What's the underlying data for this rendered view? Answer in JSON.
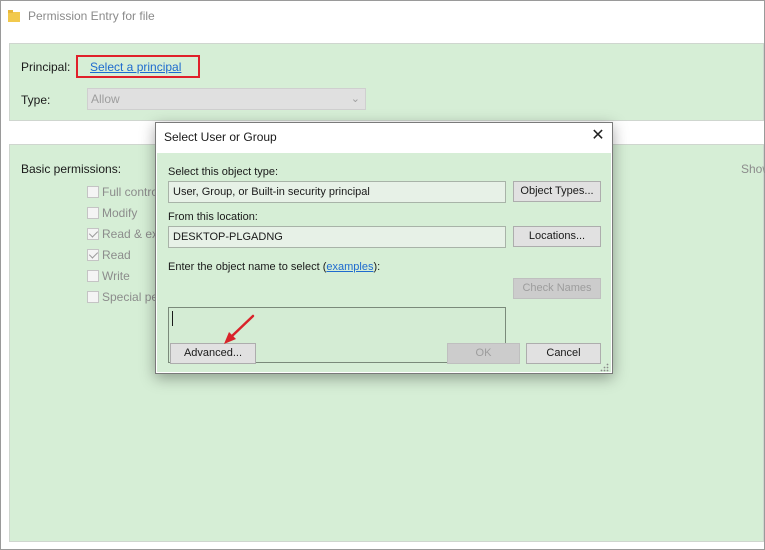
{
  "window": {
    "title": "Permission Entry for file"
  },
  "principal": {
    "label": "Principal:",
    "link_text": "Select a principal"
  },
  "type": {
    "label": "Type:",
    "selected": "Allow"
  },
  "permissions": {
    "heading": "Basic permissions:",
    "show_link": "Show",
    "items": [
      {
        "label": "Full control",
        "visible": "Full contro",
        "checked": false
      },
      {
        "label": "Modify",
        "visible": "Modify",
        "checked": false
      },
      {
        "label": "Read & execute",
        "visible": "Read & ex",
        "checked": true
      },
      {
        "label": "Read",
        "visible": "Read",
        "checked": true
      },
      {
        "label": "Write",
        "visible": "Write",
        "checked": false
      },
      {
        "label": "Special permissions",
        "visible": "Special pe",
        "checked": false
      }
    ]
  },
  "dialog": {
    "title": "Select User or Group",
    "close_glyph": "✕",
    "object_type_label": "Select this object type:",
    "object_type_value": "User, Group, or Built-in security principal",
    "object_types_button": "Object Types...",
    "location_label": "From this location:",
    "location_value": "DESKTOP-PLGADNG",
    "locations_button": "Locations...",
    "names_label_prefix": "Enter the object name to select (",
    "names_label_link": "examples",
    "names_label_suffix": "):",
    "check_names_button": "Check Names",
    "advanced_button": "Advanced...",
    "ok_button": "OK",
    "cancel_button": "Cancel"
  },
  "colors": {
    "accent_link": "#1e6bcf",
    "highlight_box": "#e0202a",
    "panel_green": "#d6eed6",
    "arrow": "#d9232a"
  },
  "icons": {
    "window": "folder-icon",
    "close": "close-icon",
    "dropdown": "chevron-down-icon",
    "resize": "resize-grip-icon",
    "annotation": "red-arrow-icon"
  }
}
